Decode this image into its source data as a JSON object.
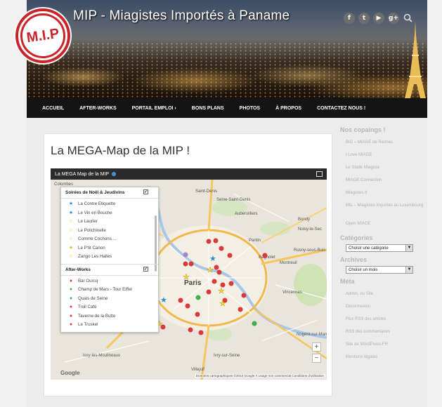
{
  "site": {
    "title": "MIP - Miagistes Importés à Paname",
    "logo_text": "M.I.P",
    "social_icons": [
      "facebook-icon",
      "twitter-icon",
      "youtube-icon",
      "googleplus-icon",
      "search-icon"
    ]
  },
  "nav": {
    "items": [
      "ACCUEIL",
      "AFTER-WORKS",
      "PORTAIL EMPLOI ›",
      "BONS PLANS",
      "PHOTOS",
      "À PROPOS",
      "CONTACTEZ NOUS !"
    ]
  },
  "post": {
    "title": "La MEGA-Map de la MIP !"
  },
  "map": {
    "header_title": "La MEGA Map de la MIP",
    "sections": [
      {
        "title": "Soirées de Noël & Jeudivins",
        "items": [
          {
            "label": "La Contre Etiquette",
            "marker": "blue-star"
          },
          {
            "label": "Le Vin en Bouche",
            "marker": "blue-star"
          },
          {
            "label": "Le Laurier",
            "marker": "yellow-star"
          },
          {
            "label": "Le Polichinelle",
            "marker": "yellow-star"
          },
          {
            "label": "Comme Cochons ...",
            "marker": "yellow-star"
          },
          {
            "label": "Le P'tit Canon",
            "marker": "yellow-star"
          },
          {
            "label": "Zango Les Halles",
            "marker": "yellow-star"
          }
        ]
      },
      {
        "title": "After-Works",
        "items": [
          {
            "label": "Bar Ourcq",
            "marker": "red-dot"
          },
          {
            "label": "Champ de Mars - Tour Eiffel",
            "marker": "green-dot"
          },
          {
            "label": "Quais de Seine",
            "marker": "green-dot"
          },
          {
            "label": "Troll Café",
            "marker": "red-dot"
          },
          {
            "label": "Taverne de la Butte",
            "marker": "red-dot"
          },
          {
            "label": "Le Truskel",
            "marker": "red-dot"
          }
        ]
      }
    ],
    "place_labels": [
      "Colombes",
      "Paris",
      "Seine-Saint-Denis",
      "Saint-Denis",
      "Aubervilliers",
      "Pantin",
      "Bondy",
      "Noisy-le-Sec",
      "Montreuil",
      "Bagnolet",
      "Rosny-sous-Bois",
      "Vincennes",
      "Ivry-sur-Seine",
      "Issy-les-Moulineaux",
      "Nogent-sur-Marne",
      "Villejuif"
    ],
    "google_label": "Google",
    "attribution": "Données cartographiques ©2014 Google   À usage non commercial   Conditions d'utilisation",
    "zoom_in": "+",
    "zoom_out": "−"
  },
  "sidebar": {
    "sections": [
      {
        "title": "Nos copaings !",
        "links": [
          "BIG – MIAGE de Rennes",
          "I Love MIAGE",
          "Le Stade Miagiste",
          "MIAGE Connection",
          "Miagistes.fr",
          "MIL – Miagistes Importés au Luxembourg",
          "Open MIAGE"
        ]
      },
      {
        "title": "Catégories",
        "select": "Choisir une catégorie"
      },
      {
        "title": "Archives",
        "select": "Choisir un mois"
      },
      {
        "title": "Méta",
        "links": [
          "Admin. du Site",
          "Déconnexion",
          "Flux RSS des articles",
          "RSS des commentaires",
          "Site de WordPress-FR",
          "Mentions légales"
        ]
      }
    ]
  },
  "colors": {
    "nav_bg": "#141414",
    "logo_red": "#c9242a",
    "marker_red": "#d9393a",
    "marker_blue": "#2e8fcf",
    "marker_yellow": "#f3d430",
    "marker_green": "#3fae4c"
  }
}
